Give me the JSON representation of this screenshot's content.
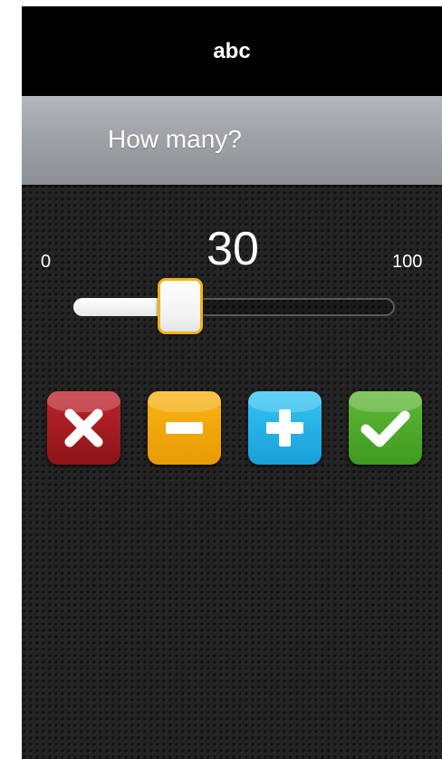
{
  "header": {
    "title": "abc"
  },
  "prompt": {
    "text": "How many?"
  },
  "slider": {
    "min_label": "0",
    "max_label": "100",
    "min": 0,
    "max": 100,
    "value": 30,
    "value_label": "30",
    "accent_color": "#f2b411"
  },
  "actions": [
    {
      "icon": "close-icon",
      "color": "#b01f26"
    },
    {
      "icon": "minus-icon",
      "color": "#f5a90e"
    },
    {
      "icon": "plus-icon",
      "color": "#27b4ea"
    },
    {
      "icon": "checkmark-icon",
      "color": "#52ab2c"
    }
  ]
}
